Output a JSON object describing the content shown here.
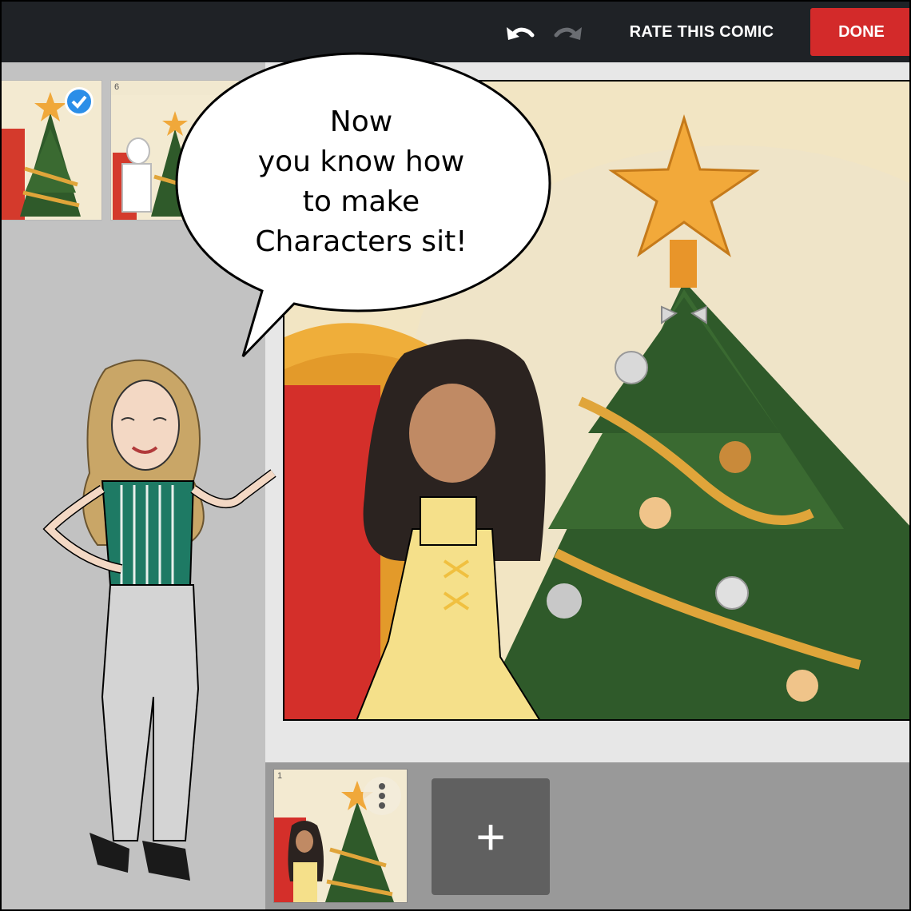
{
  "toolbar": {
    "undo_icon": "undo-icon",
    "redo_icon": "redo-icon",
    "rate_label": "RATE THIS COMIC",
    "done_label": "DONE",
    "accent_color": "#d32a2a",
    "bar_color": "#1f2226"
  },
  "panel_strip": {
    "thumbnails": [
      {
        "number": "",
        "selected": true
      },
      {
        "number": "6",
        "selected": false
      }
    ]
  },
  "speech_bubble": {
    "lines": [
      "Now",
      "you know how",
      "to make",
      "Characters sit!"
    ]
  },
  "bottom_panels": {
    "panels": [
      {
        "number": "1"
      }
    ],
    "add_label": "+"
  }
}
